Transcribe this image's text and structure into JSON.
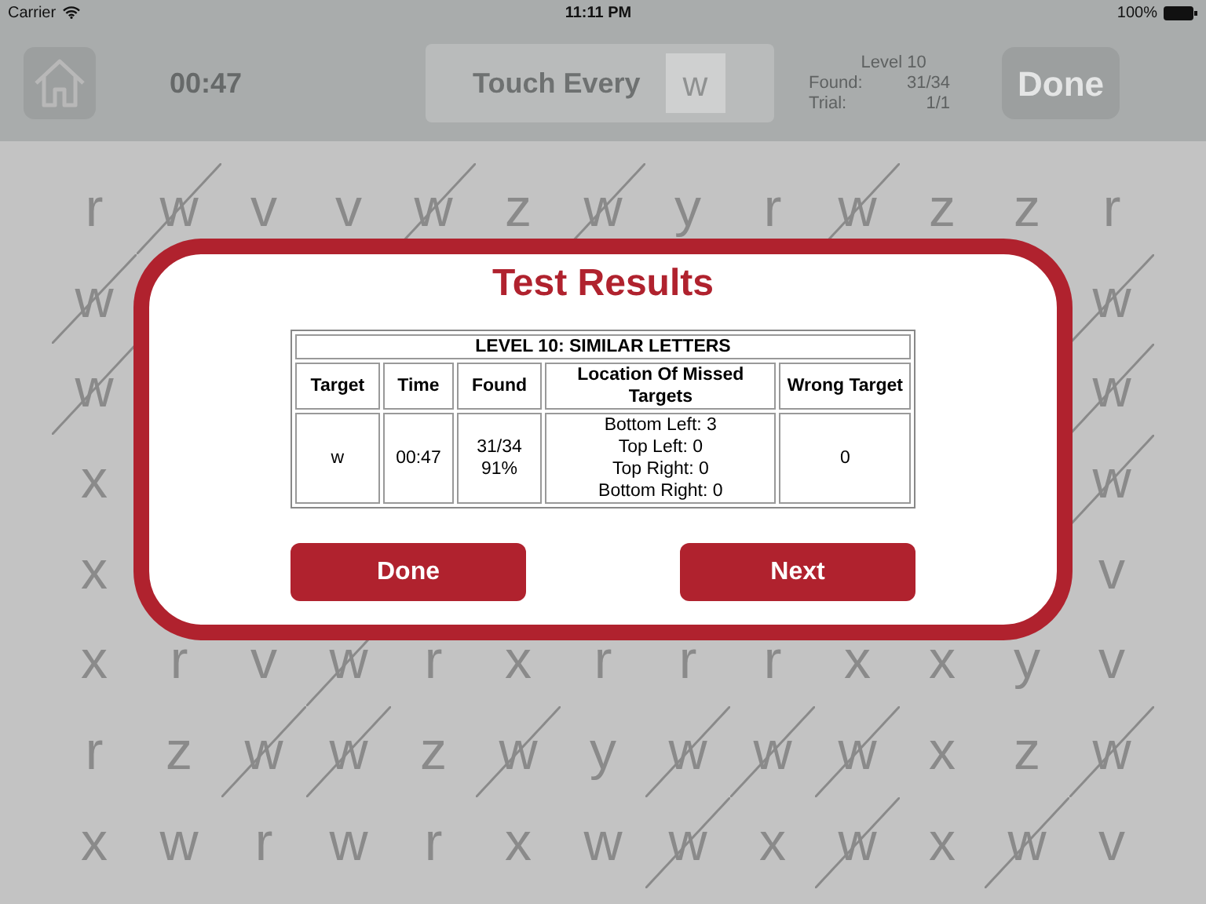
{
  "status_bar": {
    "carrier": "Carrier",
    "time": "11:11 PM",
    "battery": "100%"
  },
  "toolbar": {
    "timer": "00:47",
    "prompt": "Touch Every",
    "target": "w",
    "level": "Level 10",
    "stats": [
      {
        "label": "Found:",
        "value": "31/34"
      },
      {
        "label": "Trial:",
        "value": "1/1"
      }
    ],
    "done": "Done"
  },
  "grid": {
    "rows": [
      [
        {
          "letter": "r",
          "crossed": false
        },
        {
          "letter": "w",
          "crossed": true
        },
        {
          "letter": "v",
          "crossed": false
        },
        {
          "letter": "v",
          "crossed": false
        },
        {
          "letter": "w",
          "crossed": true
        },
        {
          "letter": "z",
          "crossed": false
        },
        {
          "letter": "w",
          "crossed": true
        },
        {
          "letter": "y",
          "crossed": false
        },
        {
          "letter": "r",
          "crossed": false
        },
        {
          "letter": "w",
          "crossed": true
        },
        {
          "letter": "z",
          "crossed": false
        },
        {
          "letter": "z",
          "crossed": false
        },
        {
          "letter": "r",
          "crossed": false
        }
      ],
      [
        {
          "letter": "w",
          "crossed": true
        },
        null,
        null,
        null,
        null,
        null,
        null,
        null,
        null,
        null,
        null,
        null,
        {
          "letter": "w",
          "crossed": true
        }
      ],
      [
        {
          "letter": "w",
          "crossed": true
        },
        null,
        null,
        null,
        null,
        null,
        null,
        null,
        null,
        null,
        null,
        null,
        {
          "letter": "w",
          "crossed": true
        }
      ],
      [
        {
          "letter": "x",
          "crossed": false
        },
        null,
        null,
        null,
        null,
        null,
        null,
        null,
        null,
        null,
        null,
        null,
        {
          "letter": "w",
          "crossed": true
        }
      ],
      [
        {
          "letter": "x",
          "crossed": false
        },
        null,
        null,
        null,
        null,
        null,
        null,
        null,
        null,
        null,
        null,
        null,
        {
          "letter": "v",
          "crossed": false
        }
      ],
      [
        {
          "letter": "x",
          "crossed": false
        },
        {
          "letter": "r",
          "crossed": false
        },
        {
          "letter": "v",
          "crossed": false
        },
        {
          "letter": "w",
          "crossed": true
        },
        {
          "letter": "r",
          "crossed": false
        },
        {
          "letter": "x",
          "crossed": false
        },
        {
          "letter": "r",
          "crossed": false
        },
        {
          "letter": "r",
          "crossed": false
        },
        {
          "letter": "r",
          "crossed": false
        },
        {
          "letter": "x",
          "crossed": false
        },
        {
          "letter": "x",
          "crossed": false
        },
        {
          "letter": "y",
          "crossed": false
        },
        {
          "letter": "v",
          "crossed": false
        }
      ],
      [
        {
          "letter": "r",
          "crossed": false
        },
        {
          "letter": "z",
          "crossed": false
        },
        {
          "letter": "w",
          "crossed": true
        },
        {
          "letter": "w",
          "crossed": true
        },
        {
          "letter": "z",
          "crossed": false
        },
        {
          "letter": "w",
          "crossed": true
        },
        {
          "letter": "y",
          "crossed": false
        },
        {
          "letter": "w",
          "crossed": true
        },
        {
          "letter": "w",
          "crossed": true
        },
        {
          "letter": "w",
          "crossed": true
        },
        {
          "letter": "x",
          "crossed": false
        },
        {
          "letter": "z",
          "crossed": false
        },
        {
          "letter": "w",
          "crossed": true
        }
      ],
      [
        {
          "letter": "x",
          "crossed": false
        },
        {
          "letter": "w",
          "crossed": false
        },
        {
          "letter": "r",
          "crossed": false
        },
        {
          "letter": "w",
          "crossed": false
        },
        {
          "letter": "r",
          "crossed": false
        },
        {
          "letter": "x",
          "crossed": false
        },
        {
          "letter": "w",
          "crossed": false
        },
        {
          "letter": "w",
          "crossed": true
        },
        {
          "letter": "x",
          "crossed": false
        },
        {
          "letter": "w",
          "crossed": true
        },
        {
          "letter": "x",
          "crossed": false
        },
        {
          "letter": "w",
          "crossed": true
        },
        {
          "letter": "v",
          "crossed": false
        }
      ]
    ]
  },
  "dialog": {
    "title": "Test Results",
    "table": {
      "caption": "LEVEL 10: SIMILAR LETTERS",
      "columns": [
        "Target",
        "Time",
        "Found",
        "Location Of Missed Targets",
        "Wrong Target"
      ],
      "rows": [
        [
          [
            "w"
          ],
          [
            "00:47"
          ],
          [
            "31/34",
            "91%"
          ],
          [
            "Bottom Left: 3",
            "Top Left: 0",
            "Top Right: 0",
            "Bottom Right: 0"
          ],
          [
            "0"
          ]
        ]
      ]
    },
    "buttons": [
      "Done",
      "Next"
    ]
  }
}
